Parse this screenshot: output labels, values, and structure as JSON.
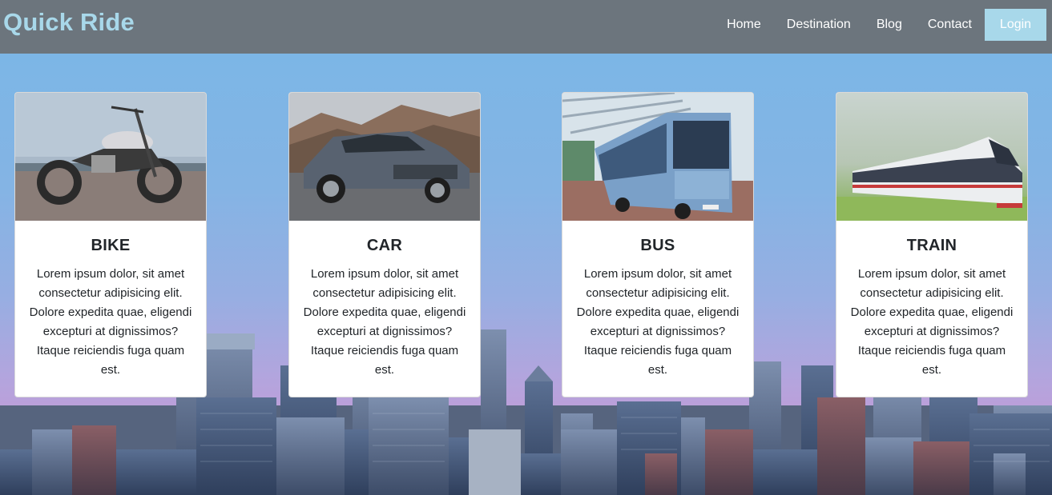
{
  "brand": "Quick Ride",
  "nav": {
    "home": "Home",
    "destination": "Destination",
    "blog": "Blog",
    "contact": "Contact",
    "login": "Login"
  },
  "cards": [
    {
      "title": "BIKE",
      "text": "Lorem ipsum dolor, sit amet consectetur adipisicing elit. Dolore expedita quae, eligendi excepturi at dignissimos? Itaque reiciendis fuga quam est."
    },
    {
      "title": "CAR",
      "text": "Lorem ipsum dolor, sit amet consectetur adipisicing elit. Dolore expedita quae, eligendi excepturi at dignissimos? Itaque reiciendis fuga quam est."
    },
    {
      "title": "BUS",
      "text": "Lorem ipsum dolor, sit amet consectetur adipisicing elit. Dolore expedita quae, eligendi excepturi at dignissimos? Itaque reiciendis fuga quam est."
    },
    {
      "title": "TRAIN",
      "text": "Lorem ipsum dolor, sit amet consectetur adipisicing elit. Dolore expedita quae, eligendi excepturi at dignissimos? Itaque reiciendis fuga quam est."
    }
  ],
  "colors": {
    "navbar": "#6c757d",
    "brand": "#a8d8ea",
    "login_button": "#a8d8ea"
  }
}
